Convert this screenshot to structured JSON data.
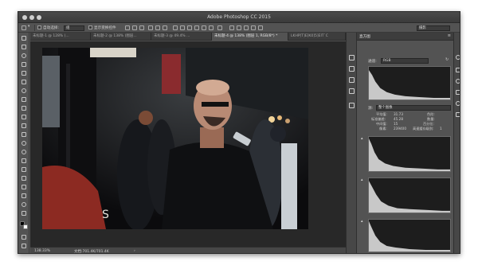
{
  "window": {
    "title": "Adobe Photoshop CC 2015"
  },
  "options_bar": {
    "auto_select_label": "自动选择:",
    "auto_select_value": "组",
    "show_transform_label": "显示变换控件",
    "workspace_value": "摄影"
  },
  "tabs": [
    {
      "label": "未标题-1 @ 128% (...",
      "active": false
    },
    {
      "label": "未标题-2 @ 138% (图层...",
      "active": false
    },
    {
      "label": "未标题-3 @ 49.4% ...",
      "active": false
    },
    {
      "label": "未标题-4 @ 138% (图层 1, RGB/8*) *",
      "active": true
    },
    {
      "label": "LKHP[T]E[K0]5]EIT`C",
      "active": false
    }
  ],
  "status": {
    "zoom": "138.33%",
    "doc": "文档:701.4K/701.4K",
    "arrow": "›"
  },
  "histogram_panel": {
    "tab_label": "直方图",
    "menu_icon": "≡",
    "channel_label": "通道:",
    "channel_value": "RGB",
    "refresh_icon": "↻",
    "source_label": "源:",
    "source_value": "整个图像",
    "stats": {
      "mean_label": "平均值:",
      "mean_value": "31.73",
      "std_dev_label": "标准偏差:",
      "std_dev_value": "45.28",
      "median_label": "中间值:",
      "median_value": "15",
      "pixels_label": "像素:",
      "pixels_value": "239400",
      "level_label": "色阶:",
      "level_value": "",
      "count_label": "数量:",
      "count_value": "",
      "percentile_label": "百分位:",
      "percentile_value": "",
      "cache_level_label": "高速缓存级别:",
      "cache_level_value": "1"
    },
    "channel_histograms": [
      "red-histogram",
      "green-histogram",
      "blue-histogram"
    ]
  },
  "icons": {
    "toolbar": [
      "move-icon",
      "marquee-icon",
      "lasso-icon",
      "magic-wand-icon",
      "crop-icon",
      "eyedropper-icon",
      "healing-brush-icon",
      "brush-icon",
      "clone-stamp-icon",
      "history-brush-icon",
      "eraser-icon",
      "gradient-icon",
      "blur-icon",
      "dodge-icon",
      "pen-icon",
      "type-icon",
      "path-selection-icon",
      "rectangle-icon",
      "hand-icon",
      "zoom-icon"
    ]
  },
  "colors": {
    "foreground": "#000000",
    "background": "#ffffff",
    "ui_dark": "#535353"
  }
}
